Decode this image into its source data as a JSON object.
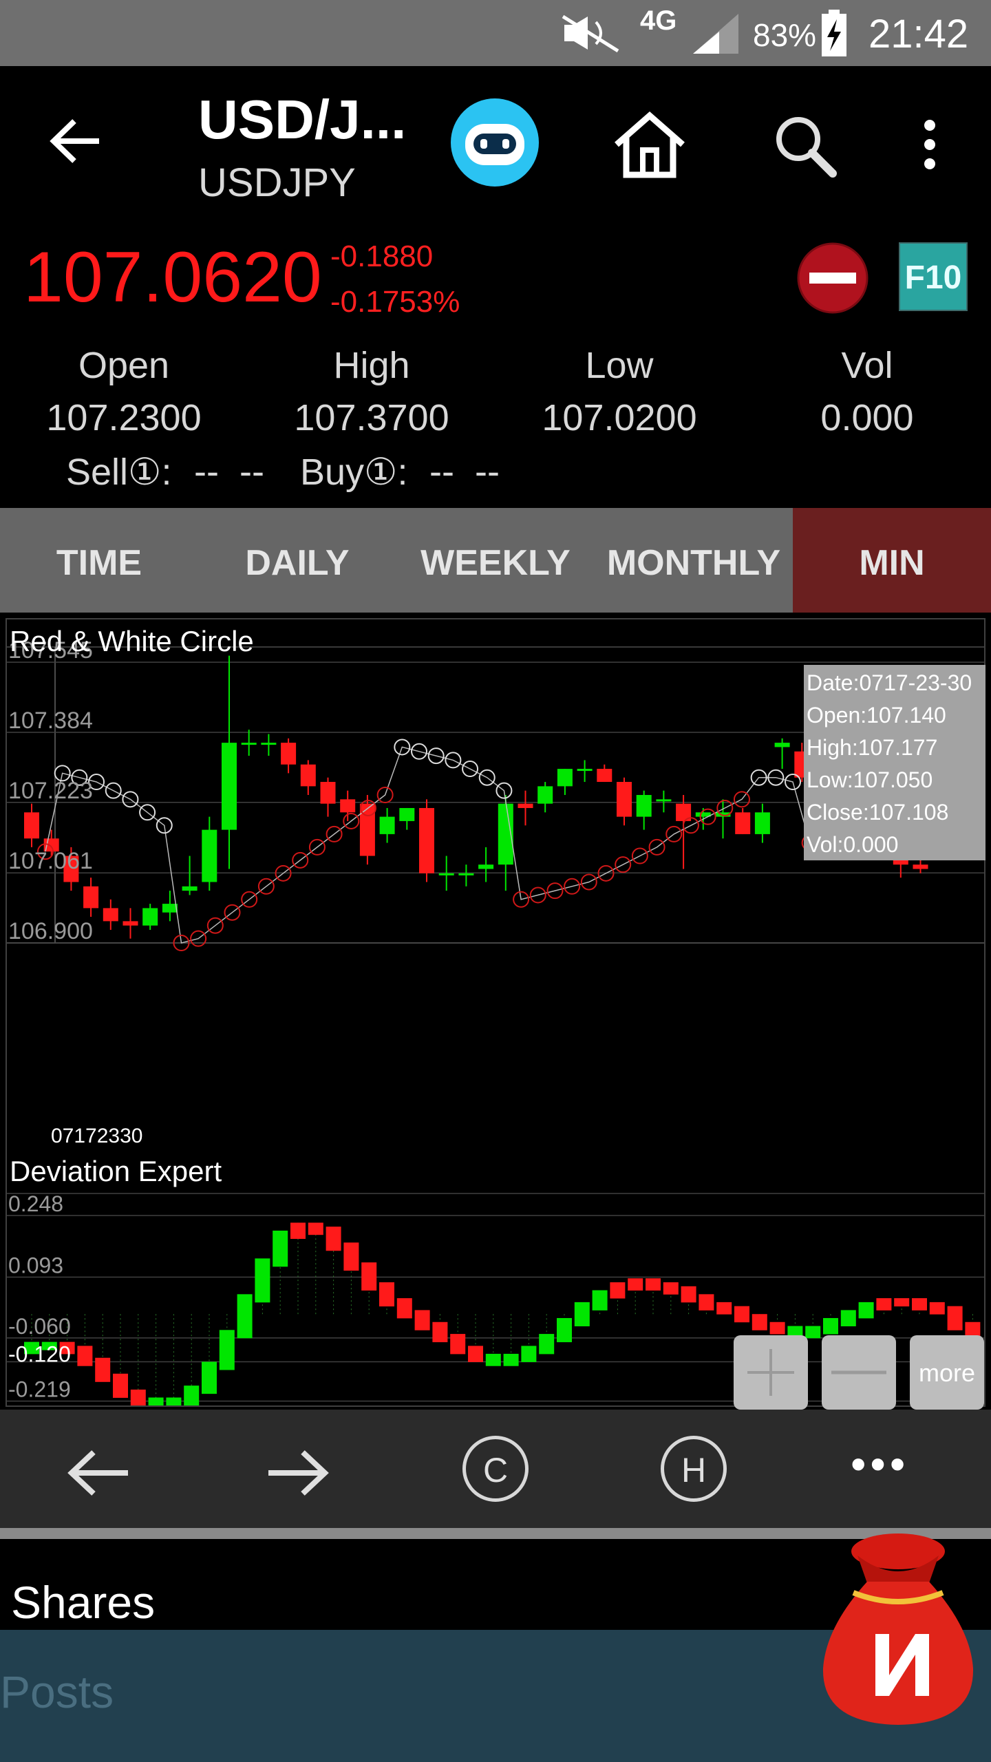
{
  "status_bar": {
    "battery": "83%",
    "time": "21:42",
    "network": "4G"
  },
  "header": {
    "title": "USD/J...",
    "symbol": "USDJPY"
  },
  "quote": {
    "price": "107.0620",
    "change": "-0.1880",
    "change_pct": "-0.1753%",
    "stats": [
      {
        "label": "Open",
        "value": "107.2300"
      },
      {
        "label": "High",
        "value": "107.3700"
      },
      {
        "label": "Low",
        "value": "107.0200"
      },
      {
        "label": "Vol",
        "value": "0.000"
      }
    ],
    "sell_label": "Sell①:",
    "sell_value": "--  --",
    "buy_label": "Buy①:",
    "buy_value": "--  --",
    "f10_label": "F10"
  },
  "tabs": [
    {
      "label": "TIME"
    },
    {
      "label": "DAILY"
    },
    {
      "label": "WEEKLY"
    },
    {
      "label": "MONTHLY"
    },
    {
      "label": "MIN",
      "active": true
    }
  ],
  "main_chart": {
    "title": "Red & White Circle",
    "y_ticks": [
      "107.545",
      "107.384",
      "107.223",
      "107.061",
      "106.900"
    ],
    "x_label": "07172330",
    "tooltip": [
      "Date:0717-23-30",
      "Open:107.140",
      "High:107.177",
      "Low:107.050",
      "Close:107.108",
      "Vol:0.000"
    ]
  },
  "sub_chart": {
    "title": "Deviation Expert",
    "y_ticks": [
      "0.248",
      "0.093",
      "-0.060",
      "-0.120",
      "-0.219"
    ]
  },
  "zoom_controls": {
    "more_label": "more"
  },
  "toolbar": {
    "c_label": "C",
    "h_label": "H",
    "more_glyph": "•••"
  },
  "footer": {
    "shares_label": "Shares",
    "posts_placeholder": "Posts"
  },
  "colors": {
    "up": "#00e600",
    "down": "#ff1a1a",
    "accent_tab": "#6a1f1f",
    "price_red": "#ff1a1a"
  },
  "chart_data": [
    {
      "type": "candlestick",
      "title": "Red & White Circle",
      "ylim": [
        106.9,
        107.58
      ],
      "y_ticks": [
        107.545,
        107.384,
        107.223,
        107.061,
        106.9
      ],
      "candles": [
        {
          "o": 107.2,
          "h": 107.22,
          "l": 107.12,
          "c": 107.14
        },
        {
          "o": 107.14,
          "h": 107.16,
          "l": 107.1,
          "c": 107.11
        },
        {
          "o": 107.1,
          "h": 107.12,
          "l": 107.02,
          "c": 107.04
        },
        {
          "o": 107.03,
          "h": 107.05,
          "l": 106.96,
          "c": 106.98
        },
        {
          "o": 106.98,
          "h": 107.0,
          "l": 106.93,
          "c": 106.95
        },
        {
          "o": 106.95,
          "h": 106.98,
          "l": 106.91,
          "c": 106.94
        },
        {
          "o": 106.94,
          "h": 106.99,
          "l": 106.93,
          "c": 106.98
        },
        {
          "o": 106.97,
          "h": 107.02,
          "l": 106.95,
          "c": 106.99
        },
        {
          "o": 107.02,
          "h": 107.1,
          "l": 107.01,
          "c": 107.03
        },
        {
          "o": 107.04,
          "h": 107.19,
          "l": 107.02,
          "c": 107.16
        },
        {
          "o": 107.16,
          "h": 107.56,
          "l": 107.07,
          "c": 107.36
        },
        {
          "o": 107.36,
          "h": 107.39,
          "l": 107.33,
          "c": 107.36
        },
        {
          "o": 107.36,
          "h": 107.38,
          "l": 107.33,
          "c": 107.36
        },
        {
          "o": 107.36,
          "h": 107.37,
          "l": 107.29,
          "c": 107.31
        },
        {
          "o": 107.31,
          "h": 107.32,
          "l": 107.24,
          "c": 107.26
        },
        {
          "o": 107.27,
          "h": 107.28,
          "l": 107.19,
          "c": 107.22
        },
        {
          "o": 107.23,
          "h": 107.25,
          "l": 107.18,
          "c": 107.2
        },
        {
          "o": 107.22,
          "h": 107.24,
          "l": 107.08,
          "c": 107.1
        },
        {
          "o": 107.15,
          "h": 107.21,
          "l": 107.13,
          "c": 107.19
        },
        {
          "o": 107.18,
          "h": 107.21,
          "l": 107.16,
          "c": 107.21
        },
        {
          "o": 107.21,
          "h": 107.23,
          "l": 107.04,
          "c": 107.06
        },
        {
          "o": 107.06,
          "h": 107.1,
          "l": 107.02,
          "c": 107.06
        },
        {
          "o": 107.06,
          "h": 107.08,
          "l": 107.03,
          "c": 107.06
        },
        {
          "o": 107.07,
          "h": 107.12,
          "l": 107.04,
          "c": 107.08
        },
        {
          "o": 107.08,
          "h": 107.24,
          "l": 107.02,
          "c": 107.22
        },
        {
          "o": 107.22,
          "h": 107.25,
          "l": 107.17,
          "c": 107.21
        },
        {
          "o": 107.22,
          "h": 107.27,
          "l": 107.2,
          "c": 107.26
        },
        {
          "o": 107.26,
          "h": 107.3,
          "l": 107.24,
          "c": 107.3
        },
        {
          "o": 107.3,
          "h": 107.32,
          "l": 107.27,
          "c": 107.3
        },
        {
          "o": 107.3,
          "h": 107.31,
          "l": 107.27,
          "c": 107.27
        },
        {
          "o": 107.27,
          "h": 107.28,
          "l": 107.17,
          "c": 107.19
        },
        {
          "o": 107.19,
          "h": 107.25,
          "l": 107.16,
          "c": 107.24
        },
        {
          "o": 107.23,
          "h": 107.25,
          "l": 107.2,
          "c": 107.23
        },
        {
          "o": 107.22,
          "h": 107.24,
          "l": 107.07,
          "c": 107.18
        },
        {
          "o": 107.19,
          "h": 107.21,
          "l": 107.16,
          "c": 107.2
        },
        {
          "o": 107.19,
          "h": 107.23,
          "l": 107.14,
          "c": 107.2
        },
        {
          "o": 107.2,
          "h": 107.21,
          "l": 107.15,
          "c": 107.15
        },
        {
          "o": 107.15,
          "h": 107.22,
          "l": 107.13,
          "c": 107.2
        },
        {
          "o": 107.35,
          "h": 107.37,
          "l": 107.3,
          "c": 107.36
        },
        {
          "o": 107.34,
          "h": 107.36,
          "l": 107.27,
          "c": 107.28
        },
        {
          "o": 107.28,
          "h": 107.3,
          "l": 107.25,
          "c": 107.29
        },
        {
          "o": 107.29,
          "h": 107.31,
          "l": 107.23,
          "c": 107.24
        },
        {
          "o": 107.23,
          "h": 107.32,
          "l": 107.22,
          "c": 107.31
        },
        {
          "o": 107.31,
          "h": 107.33,
          "l": 107.09,
          "c": 107.13
        },
        {
          "o": 107.13,
          "h": 107.15,
          "l": 107.05,
          "c": 107.08
        },
        {
          "o": 107.08,
          "h": 107.1,
          "l": 107.06,
          "c": 107.07
        }
      ],
      "upper_circles": [
        107.11,
        107.29,
        107.28,
        107.27,
        107.25,
        107.23,
        107.2,
        107.17,
        106.9,
        106.91,
        106.94,
        106.97,
        107.0,
        107.03,
        107.06,
        107.09,
        107.12,
        107.15,
        107.18,
        107.21,
        107.24,
        107.35,
        107.34,
        107.33,
        107.32,
        107.3,
        107.28,
        107.25,
        107.0,
        107.01,
        107.02,
        107.03,
        107.04,
        107.06,
        107.08,
        107.1,
        107.12,
        107.15,
        107.17,
        107.19,
        107.21,
        107.23,
        107.28,
        107.28,
        107.27,
        107.13,
        107.12,
        107.12,
        107.13,
        107.14,
        107.15,
        107.17,
        107.19,
        107.35,
        107.35
      ]
    },
    {
      "type": "bar",
      "title": "Deviation Expert",
      "ylim": [
        -0.23,
        0.3
      ],
      "y_ticks": [
        0.248,
        0.093,
        -0.06,
        -0.12,
        -0.219
      ],
      "values": [
        -0.07,
        -0.07,
        -0.08,
        -0.11,
        -0.15,
        -0.19,
        -0.21,
        -0.22,
        -0.21,
        -0.18,
        -0.12,
        -0.04,
        0.05,
        0.14,
        0.21,
        0.23,
        0.22,
        0.18,
        0.13,
        0.08,
        0.04,
        0.01,
        -0.02,
        -0.05,
        -0.08,
        -0.1,
        -0.11,
        -0.1,
        -0.08,
        -0.05,
        -0.01,
        0.03,
        0.06,
        0.08,
        0.09,
        0.08,
        0.07,
        0.05,
        0.03,
        0.02,
        0.0,
        -0.02,
        -0.03,
        -0.04,
        -0.03,
        -0.01,
        0.01,
        0.03,
        0.04,
        0.04,
        0.03,
        0.02,
        -0.02,
        -0.05
      ],
      "signs": [
        "down",
        "down",
        "up",
        "up",
        "up",
        "up",
        "up",
        "down",
        "down",
        "down",
        "down",
        "down",
        "down",
        "down",
        "down",
        "up",
        "up",
        "up",
        "up",
        "up",
        "up",
        "up",
        "up",
        "up",
        "up",
        "up",
        "down",
        "down",
        "down",
        "down",
        "down",
        "down",
        "down",
        "up",
        "up",
        "up",
        "up",
        "up",
        "up",
        "up",
        "up",
        "up",
        "up",
        "down",
        "down",
        "down",
        "down",
        "down",
        "up",
        "up",
        "up",
        "up",
        "up",
        "up"
      ]
    }
  ]
}
